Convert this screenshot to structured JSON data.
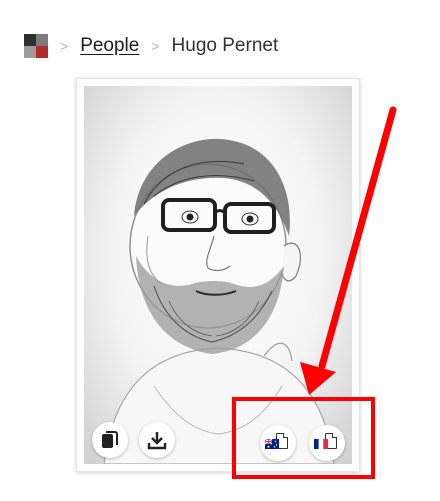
{
  "breadcrumb": {
    "separator": ">",
    "people_label": "People",
    "current_label": "Hugo Pernet"
  },
  "logo": {
    "colors": [
      "#2f2f2f",
      "#7b7b7b",
      "#9c9c9c",
      "#b32b2b"
    ]
  },
  "card": {
    "photo_icon": "person-portrait-icon",
    "actions": {
      "left": [
        {
          "name": "copy",
          "icon": "copy-icon"
        },
        {
          "name": "download",
          "icon": "download-icon"
        }
      ],
      "right": [
        {
          "name": "australia-language",
          "icon": "australia-flag-document-icon"
        },
        {
          "name": "france-language",
          "icon": "france-flag-document-icon"
        }
      ]
    }
  },
  "annotation": {
    "color": "#ff0000",
    "arrow_icon": "red-arrow-icon",
    "box_icon": "red-highlight-box"
  }
}
